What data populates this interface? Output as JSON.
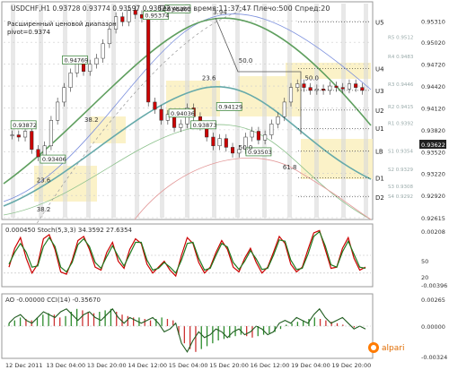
{
  "window": {
    "symbol_line": "USDCHF,H1  0.93728 0.93774 0.93597 0.93622",
    "server_time_line": "Текущее время:11:37:47 Плечо:500 Спред:20",
    "range_label": "Расширенный ценовой диапазон",
    "pivot_label": "pivot=0.9374"
  },
  "level_labels": [
    {
      "name": "U5",
      "price": 0.953
    },
    {
      "name": "U4",
      "price": 0.9466
    },
    {
      "name": "U3",
      "price": 0.9436
    },
    {
      "name": "U2",
      "price": 0.9409
    },
    {
      "name": "U1",
      "price": 0.9384
    },
    {
      "name": "LB",
      "price": 0.9353
    },
    {
      "name": "D1",
      "price": 0.9316
    },
    {
      "name": "D2",
      "price": 0.929
    }
  ],
  "r_labels": [
    {
      "text": "R5 0.9512",
      "price": 0.951
    },
    {
      "text": "R4 0.9483",
      "price": 0.9484
    },
    {
      "text": "R3 0.9446",
      "price": 0.9446
    },
    {
      "text": "R2 0.9415",
      "price": 0.9415
    },
    {
      "text": "R1 0.9392",
      "price": 0.9392
    },
    {
      "text": "S1 0.9354",
      "price": 0.9354
    },
    {
      "text": "S2 0.9329",
      "price": 0.9329
    },
    {
      "text": "S3 0.9308",
      "price": 0.9306
    },
    {
      "text": "S4 0.9292",
      "price": 0.9292
    }
  ],
  "price_axis": {
    "ticks": [
      "0.95310",
      "0.95020",
      "0.94720",
      "0.94420",
      "0.94120",
      "0.93820",
      "0.93520",
      "0.93220",
      "0.92920",
      "0.92615"
    ],
    "current": "0.93622"
  },
  "price_markers": [
    {
      "text": "0.95374",
      "price": 0.9537
    },
    {
      "text": "0.95463",
      "price": 0.9546
    },
    {
      "text": "0.94769",
      "price": 0.9476
    },
    {
      "text": "0.94036",
      "price": 0.9403
    },
    {
      "text": "0.94129",
      "price": 0.9412
    },
    {
      "text": "0.93873",
      "price": 0.9387
    },
    {
      "text": "0.93872",
      "price": 0.9387
    },
    {
      "text": "0.93406",
      "price": 0.934
    },
    {
      "text": "0.93503",
      "price": 0.935
    }
  ],
  "fib_labels": [
    {
      "text": "23.6",
      "price": 0.945
    },
    {
      "text": "38.2",
      "price": 0.9393
    },
    {
      "text": "50.0",
      "price": 0.9474
    },
    {
      "text": "50.0",
      "price": 0.945
    },
    {
      "text": "50.0",
      "price": 0.9355
    },
    {
      "text": "61.8",
      "price": 0.9328
    },
    {
      "text": "23.6",
      "price": 0.931
    },
    {
      "text": "38.2",
      "price": 0.927
    },
    {
      "text": "3.94",
      "price": 0.954
    }
  ],
  "stoch": {
    "title": "0.000450  Stoch(5,3,3) 34.3592 27.6354",
    "axis": [
      "0.00208",
      "50",
      "20",
      "-0.00396"
    ],
    "main": [
      30,
      62,
      80,
      45,
      20,
      35,
      78,
      85,
      60,
      22,
      18,
      42,
      75,
      82,
      60,
      30,
      25,
      55,
      72,
      40,
      28,
      60,
      78,
      70,
      35,
      20,
      30,
      40,
      25,
      15,
      50,
      80,
      70,
      38,
      20,
      30,
      55,
      75,
      60,
      30,
      22,
      45,
      62,
      38,
      20,
      30,
      55,
      82,
      70,
      35,
      22,
      30,
      60,
      88,
      92,
      60,
      28,
      30,
      62,
      80,
      45,
      25,
      30
    ],
    "signal": [
      35,
      55,
      70,
      55,
      30,
      32,
      65,
      80,
      65,
      30,
      22,
      38,
      68,
      78,
      65,
      38,
      28,
      48,
      66,
      48,
      32,
      52,
      72,
      72,
      42,
      25,
      28,
      38,
      30,
      20,
      42,
      70,
      72,
      45,
      25,
      28,
      50,
      70,
      64,
      38,
      26,
      40,
      58,
      44,
      26,
      28,
      50,
      76,
      74,
      42,
      26,
      28,
      52,
      82,
      90,
      66,
      34,
      30,
      56,
      74,
      52,
      30,
      28
    ]
  },
  "osc": {
    "title": "AO -0.00000  CCI(14) -0.35670",
    "axis": [
      "0.00265",
      "0.00000",
      "-0.00324"
    ],
    "ao": [
      0.1,
      0.2,
      0.3,
      0.25,
      0.2,
      0.3,
      0.4,
      0.45,
      0.4,
      0.3,
      0.35,
      0.5,
      0.6,
      0.55,
      0.5,
      0.45,
      0.5,
      0.55,
      0.6,
      0.5,
      0.4,
      0.35,
      0.3,
      0.3,
      0.25,
      0.2,
      0.25,
      0.3,
      0.25,
      0.2,
      -0.3,
      -0.6,
      -0.8,
      -0.9,
      -0.8,
      -0.7,
      -0.6,
      -0.5,
      -0.45,
      -0.4,
      -0.35,
      -0.3,
      -0.35,
      -0.4,
      -0.35,
      -0.3,
      -0.25,
      -0.2,
      -0.1,
      0.05,
      0.1,
      0.15,
      0.2,
      0.25,
      0.3,
      0.25,
      0.2,
      0.15,
      0.1,
      0.05,
      0.0,
      -0.05,
      -0.02
    ],
    "cci": [
      0.1,
      0.3,
      0.4,
      0.2,
      0.1,
      0.3,
      0.5,
      0.4,
      0.3,
      0.5,
      0.6,
      0.4,
      0.2,
      0.4,
      0.5,
      0.3,
      0.2,
      0.4,
      0.6,
      0.3,
      0.1,
      0.3,
      0.2,
      0.1,
      0.2,
      0.3,
      0.1,
      -0.2,
      -0.1,
      0.1,
      -0.6,
      -0.9,
      -0.5,
      -0.2,
      -0.4,
      -0.3,
      -0.1,
      -0.2,
      -0.4,
      -0.2,
      -0.1,
      -0.3,
      -0.2,
      0.0,
      -0.1,
      -0.3,
      -0.2,
      0.1,
      0.2,
      0.1,
      0.3,
      0.2,
      0.1,
      0.4,
      0.6,
      0.3,
      0.1,
      0.2,
      0.3,
      0.1,
      -0.1,
      0.0,
      -0.1
    ]
  },
  "time_axis": {
    "labels": [
      "12 Dec 2011",
      "13 Dec 04:00",
      "13 Dec 20:00",
      "14 Dec 12:00",
      "15 Dec 04:00",
      "15 Dec 20:00",
      "16 Dec 12:00",
      "19 Dec 04:00",
      "19 Dec 20:00"
    ]
  },
  "broker_logo": "alpari",
  "colors": {
    "candle": "#cc0000",
    "bb_band": "#66aaaa",
    "ma_fast": "#2d7c2d",
    "ma_slow": "#5b7f15",
    "fib_zone": "#fbf1c2",
    "stoch_main": "#cc0000",
    "stoch_signal": "#1f7a1f",
    "ao_up": "#2d8c2d",
    "ao_down": "#cc3333"
  },
  "chart_data": {
    "type": "line",
    "title": "USDCHF,H1",
    "ylim": [
      0.92615,
      0.9555
    ],
    "series": [
      {
        "name": "USDCHF",
        "values": [
          0.9375,
          0.9372,
          0.938,
          0.9355,
          0.9345,
          0.936,
          0.9395,
          0.942,
          0.944,
          0.946,
          0.9476,
          0.9462,
          0.9472,
          0.948,
          0.95,
          0.952,
          0.9537,
          0.953,
          0.9546,
          0.954,
          0.9535,
          0.942,
          0.941,
          0.9395,
          0.9403,
          0.9385,
          0.939,
          0.9412,
          0.94,
          0.9387,
          0.9372,
          0.936,
          0.937,
          0.9358,
          0.935,
          0.9355,
          0.9372,
          0.938,
          0.9368,
          0.9375,
          0.939,
          0.94,
          0.942,
          0.944,
          0.9445,
          0.944,
          0.9436,
          0.9438,
          0.9436,
          0.9442,
          0.944,
          0.9438,
          0.9445,
          0.944,
          0.9436
        ]
      }
    ]
  }
}
